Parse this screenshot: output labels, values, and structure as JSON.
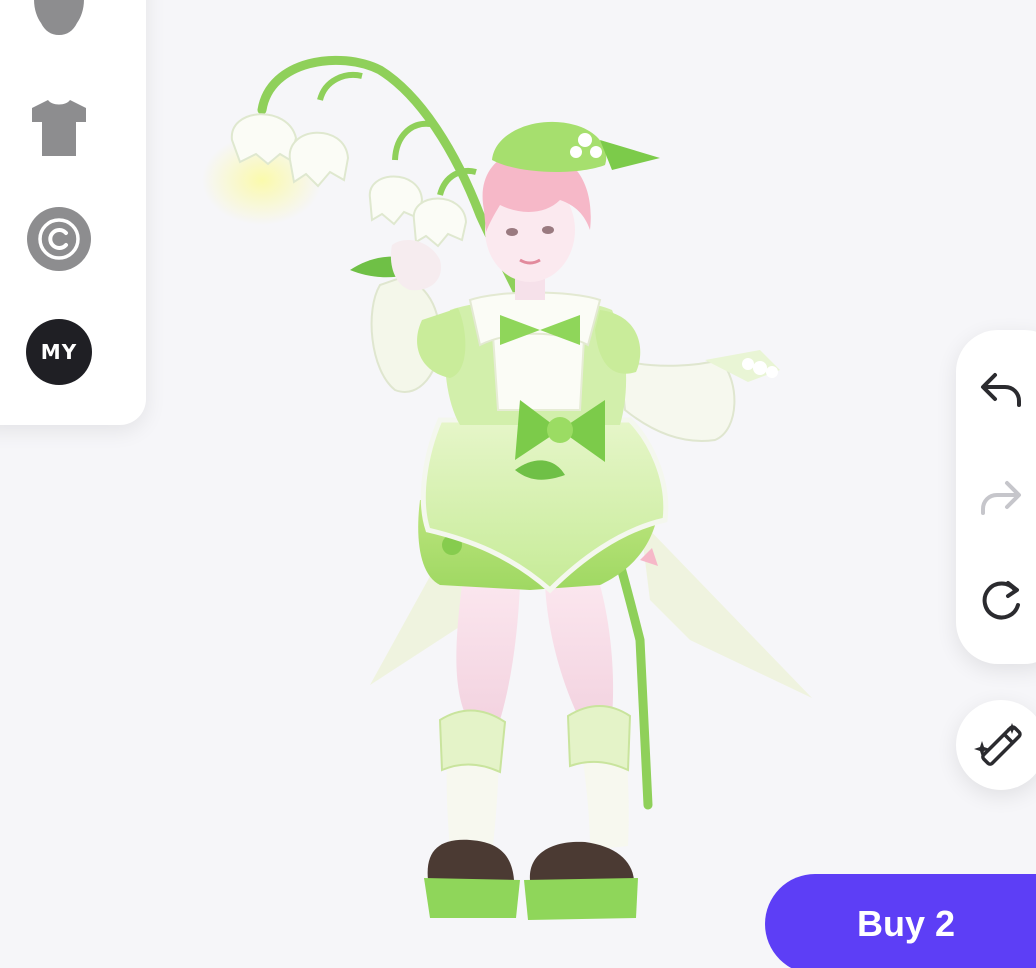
{
  "left_panel": {
    "categories": [
      {
        "name": "body",
        "icon": "body-silhouette-icon"
      },
      {
        "name": "clothing",
        "icon": "tshirt-icon"
      },
      {
        "name": "creator",
        "icon": "copyright-icon"
      },
      {
        "name": "my",
        "icon": "my-badge",
        "label": "MY"
      }
    ]
  },
  "tools": {
    "undo_icon": "undo-arrow-icon",
    "redo_icon": "redo-arrow-icon",
    "reset_icon": "reset-rotate-icon",
    "magic_icon": "magic-wand-icon",
    "redo_enabled": false
  },
  "purchase": {
    "buy_label": "Buy 2"
  },
  "colors": {
    "accent": "#5d3ef6",
    "panel_icon": "#8d8d8f",
    "my_badge": "#1f1f24",
    "outfit_green": "#a6df6e",
    "outfit_light_green": "#dbf2bf",
    "hair_pink": "#f6b8c8"
  }
}
